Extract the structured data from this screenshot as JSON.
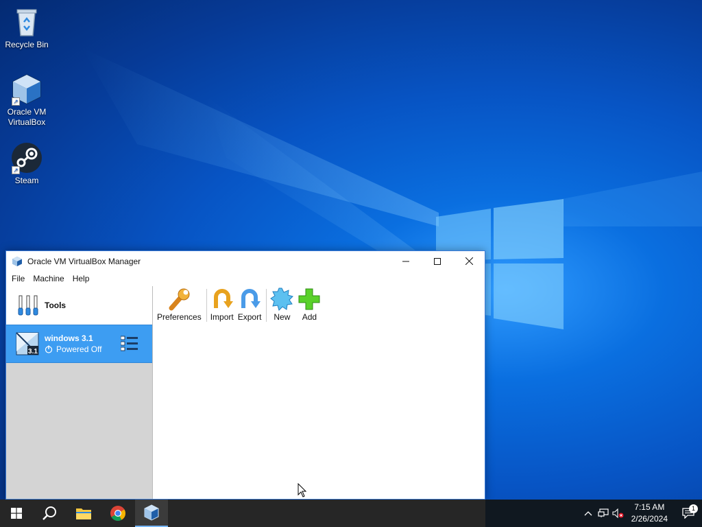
{
  "desktop": {
    "icons": [
      {
        "label": "Recycle Bin"
      },
      {
        "label": "Oracle VM\nVirtualBox"
      },
      {
        "label": "Steam"
      }
    ]
  },
  "window": {
    "title": "Oracle VM VirtualBox Manager",
    "menu": [
      "File",
      "Machine",
      "Help"
    ],
    "tools_label": "Tools",
    "vm": {
      "name": "windows 3.1",
      "state": "Powered Off",
      "badge": "3.1"
    },
    "toolbar": {
      "preferences": "Preferences",
      "import": "Import",
      "export": "Export",
      "new": "New",
      "add": "Add"
    }
  },
  "taskbar": {
    "time": "7:15 AM",
    "date": "2/26/2024",
    "notification_count": "1"
  },
  "colors": {
    "accent": "#3d9df2",
    "taskbar": "#262626"
  }
}
